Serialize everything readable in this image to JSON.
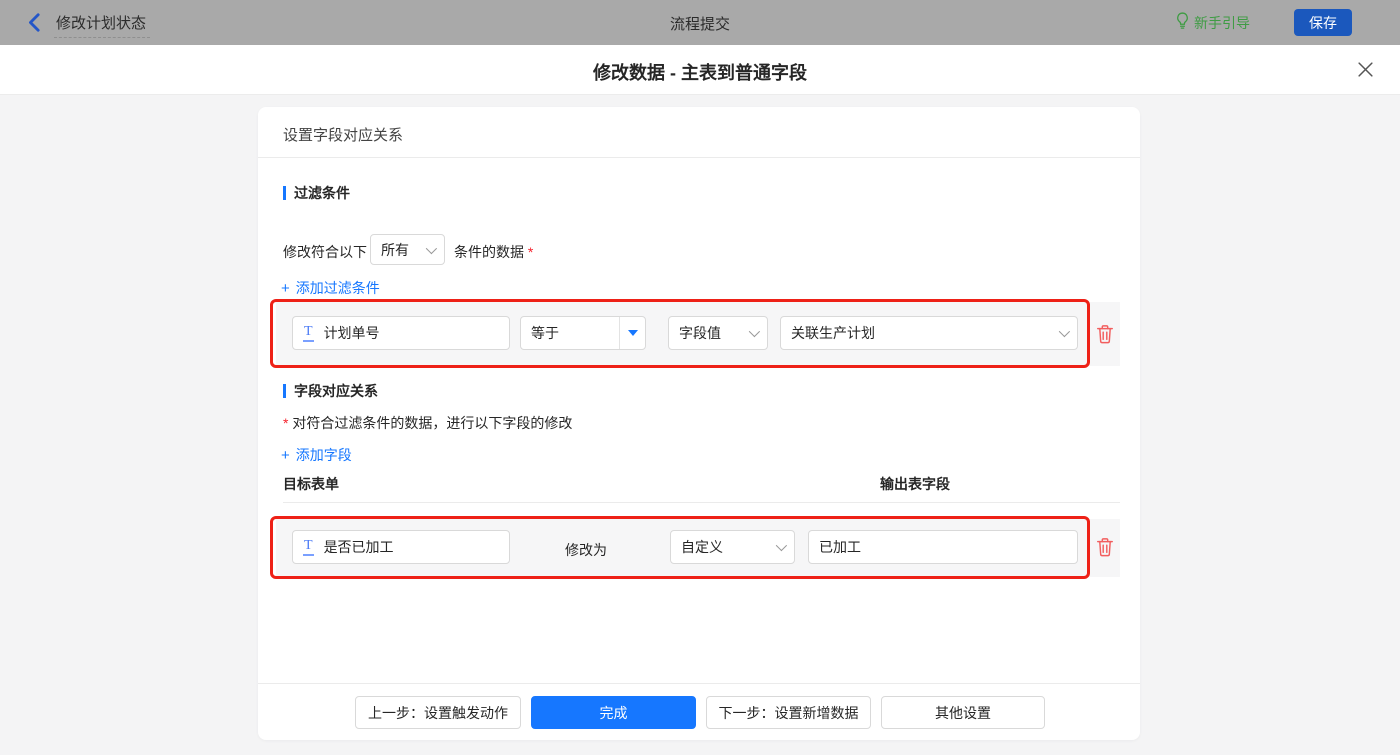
{
  "icons": {
    "plus": "+",
    "text_field": "T"
  },
  "topbar": {
    "back_title": "修改计划状态",
    "center_title": "流程提交",
    "guide_label": "新手引导",
    "save_label": "保存"
  },
  "dialog": {
    "title": "修改数据 - 主表到普通字段"
  },
  "panel": {
    "header": "设置字段对应关系"
  },
  "filter": {
    "section_title": "过滤条件",
    "match_prefix": "修改符合以下",
    "match_value": "所有",
    "match_suffix": "条件的数据",
    "required_mark": "*",
    "add_label": "添加过滤条件",
    "row": {
      "field": "计划单号",
      "operator": "等于",
      "value_type": "字段值",
      "value": "关联生产计划"
    }
  },
  "mapping": {
    "section_title": "字段对应关系",
    "required_mark": "*",
    "description": "对符合过滤条件的数据，进行以下字段的修改",
    "add_label": "添加字段",
    "columns": {
      "target": "目标表单",
      "output": "输出表字段"
    },
    "row": {
      "field": "是否已加工",
      "modify_label": "修改为",
      "mode": "自定义",
      "value": "已加工"
    }
  },
  "footer": {
    "prev": "上一步：设置触发动作",
    "finish": "完成",
    "next": "下一步：设置新增数据",
    "other": "其他设置"
  },
  "colors": {
    "accent_blue": "#1677ff",
    "save_blue": "#1b58bd",
    "guide_green": "#3f9c44",
    "highlight_red": "#ee2117",
    "danger_red": "#f25e5e"
  }
}
